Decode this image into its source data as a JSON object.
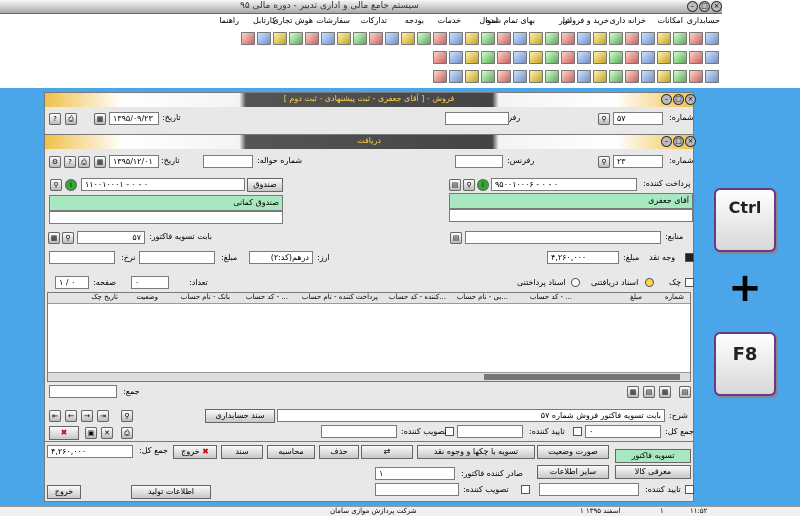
{
  "app": {
    "title": "سیستم جامع مالی و اداری تدبیر - دوره مالی ۹۵"
  },
  "menu": [
    "حسابداری",
    "امکانات",
    "خزانه داری",
    "خرید و فروش",
    "انبار",
    "بهای تمام شده",
    "اموال",
    "خدمات",
    "بودجه",
    "تدارکات",
    "سفارشات",
    "هوش تجاری",
    "کارتابل",
    "راهنما"
  ],
  "win1": {
    "title": "فروش - [ آقای جعفری - ثبت پیشنهادی - ثبت دوم ]",
    "number_label": "شماره:",
    "number": "۵۷",
    "ref_label": "رفرنس:",
    "ref": "",
    "date_label": "تاریخ:",
    "date": "۱۳۹۵/۰۹/۲۳"
  },
  "win2": {
    "title": "دریافت",
    "number_label": "شماره:",
    "number": "۲۳",
    "ref_label": "رفرنس:",
    "ref": "",
    "transfer_label": "شماره حواله:",
    "transfer": "",
    "date_label": "تاریخ:",
    "date": "۱۳۹۵/۱۲/۰۱",
    "payer_label": "پرداخت کننده:",
    "payer_code": "۹۵۰۰۱۰۰۰۶ - ۰ - ۰",
    "payer_name": "آقای جعفری",
    "fund_label": "صندوق",
    "fund_code": "۱۱۰۰۱۰۰۰۱ - ۰ - ۰",
    "fund_name": "صندوق کمانی",
    "resources_label": "منابع:",
    "for_label": "بابت تسویه فاکتور:",
    "for_value": "۵۷",
    "cash_label": "وجه نقد",
    "amount_label": "مبلغ:",
    "amount": "۴,۲۶۰,۰۰۰",
    "currency_label": "ارز:",
    "currency_value": "درهم(کد:۲)",
    "currency_amount_label": "مبلغ:",
    "rate_label": "نرخ:",
    "check_label": "چک",
    "radio_received": "اسناد دریافتنی",
    "radio_paid": "اسناد پرداختنی",
    "count_label": "تعداد:",
    "count": "۰",
    "page_label": "صفحه:",
    "page": "۱ / ۰",
    "table_headers": [
      "شماره",
      "مبلغ",
      "... - کد حساب",
      "...بی - نام حساب",
      "...کننده - کد حساب",
      "پرداخت کننده - نام حساب",
      "... - کد حساب",
      "بانک - نام حساب",
      "وضعیت",
      "تاریخ چک"
    ],
    "total_label": "جمع:",
    "desc_label": "شرح:",
    "desc": "بابت تسویه فاکتور فروش شماره ۵۷",
    "doc_btn": "سند حسابداری",
    "sum_all_label": "جمع کل:",
    "sum_all": "۰",
    "confirm_label": "تایید کننده:",
    "approve_label": "تصویب کننده:"
  },
  "win1bottom": {
    "sum_label": "جمع کل:",
    "sum": "۴,۲۶۰,۰۰۰",
    "exit_btn": "خروج",
    "doc_btn": "سند",
    "calc_btn": "محاسبه",
    "delete_btn": "حذف",
    "settle_btn": "تسویه با چکها و وجوه نقد",
    "statement_btn": "صورت وضعیت",
    "settle_invoice_btn": "تسویه فاکتور",
    "introduce_btn": "معرفی کالا",
    "other_btn": "سایر اطلاعات",
    "issuer_label": "صادر کننده فاکتور:",
    "issuer": "۱",
    "approve_label": "تصویب کننده:",
    "confirm_label": "تایید کننده:",
    "prod_btn": "اطلاعات تولید",
    "exit2_btn": "خروج"
  },
  "keys": {
    "k1": "Ctrl",
    "plus": "+",
    "k2": "F8"
  },
  "status": {
    "company": "شرکت پردازش موازی سامان",
    "date": "۱ اسفند ۱۳۹۵",
    "user": "۱",
    "time": "۱۱:۵۲"
  }
}
